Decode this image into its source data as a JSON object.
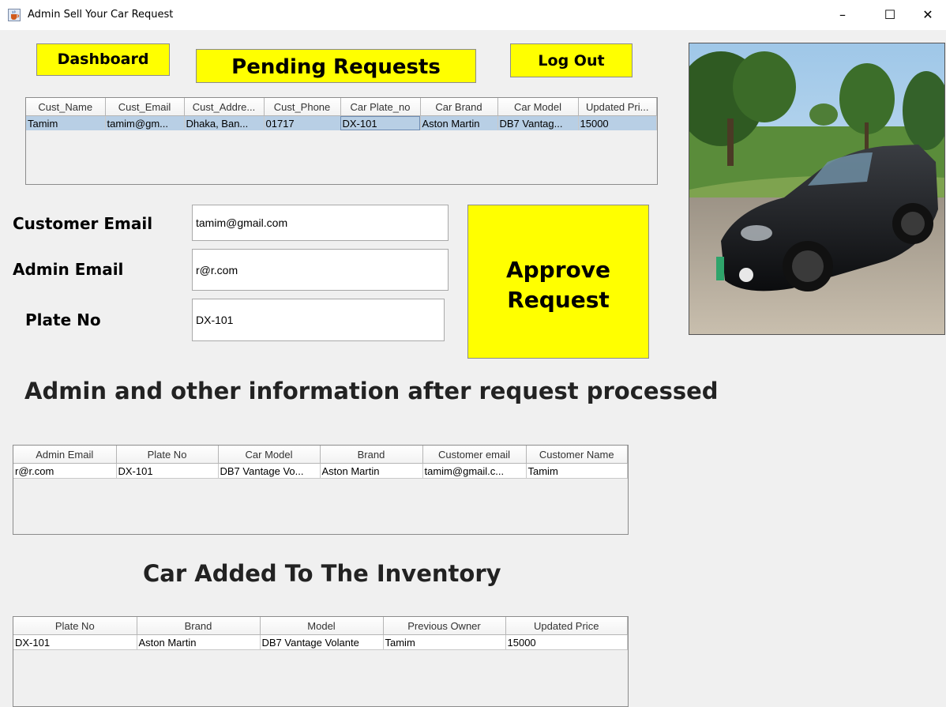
{
  "window": {
    "title": "Admin Sell Your Car Request",
    "minimize": "–",
    "maximize": "☐",
    "close": "✕"
  },
  "buttons": {
    "dashboard": "Dashboard",
    "pending": "Pending Requests",
    "logout": "Log Out",
    "approve_line1": "Approve",
    "approve_line2": "Request"
  },
  "pending_table": {
    "headers": [
      "Cust_Name",
      "Cust_Email",
      "Cust_Addre...",
      "Cust_Phone",
      "Car Plate_no",
      "Car Brand",
      "Car Model",
      "Updated Pri..."
    ],
    "rows": [
      [
        "Tamim",
        "tamim@gm...",
        "Dhaka, Ban...",
        "01717",
        "DX-101",
        "Aston Martin",
        "DB7 Vantag...",
        "15000"
      ]
    ]
  },
  "form": {
    "customer_email_label": "Customer Email",
    "customer_email_value": "tamim@gmail.com",
    "admin_email_label": "Admin Email",
    "admin_email_value": "r@r.com",
    "plate_label": "Plate No",
    "plate_value": "DX-101"
  },
  "headings": {
    "processed": "Admin and other information after request processed",
    "inventory": "Car Added To The Inventory"
  },
  "processed_table": {
    "headers": [
      "Admin Email",
      "Plate No",
      "Car Model",
      "Brand",
      "Customer email",
      "Customer Name"
    ],
    "rows": [
      [
        "r@r.com",
        "DX-101",
        "DB7 Vantage Vo...",
        "Aston Martin",
        "tamim@gmail.c...",
        "Tamim"
      ]
    ]
  },
  "inventory_table": {
    "headers": [
      "Plate No",
      "Brand",
      "Model",
      "Previous Owner",
      "Updated Price"
    ],
    "rows": [
      [
        "DX-101",
        "Aston Martin",
        "DB7 Vantage Volante",
        "Tamim",
        "15000"
      ]
    ]
  },
  "colors": {
    "button_yellow": "#ffff00",
    "selection": "#b8cfe5",
    "window_bg": "#f0f0f0"
  },
  "icons": {
    "app": "java-cup-icon",
    "photo": "black-convertible-car-photo"
  }
}
